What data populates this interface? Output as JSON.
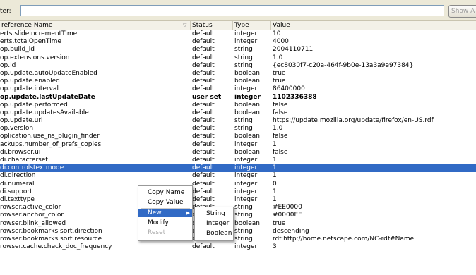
{
  "filter": {
    "label": "ter:",
    "value": "",
    "show_button": "Show A"
  },
  "columns": {
    "name": "reference Name",
    "status": "Status",
    "type": "Type",
    "value": "Value"
  },
  "rows": [
    {
      "name": "erts.slideIncrementTime",
      "status": "default",
      "type": "integer",
      "value": "10"
    },
    {
      "name": "erts.totalOpenTime",
      "status": "default",
      "type": "integer",
      "value": "4000"
    },
    {
      "name": "op.build_id",
      "status": "default",
      "type": "string",
      "value": "2004110711"
    },
    {
      "name": "op.extensions.version",
      "status": "default",
      "type": "string",
      "value": "1.0"
    },
    {
      "name": "op.id",
      "status": "default",
      "type": "string",
      "value": "{ec8030f7-c20a-464f-9b0e-13a3a9e97384}"
    },
    {
      "name": "op.update.autoUpdateEnabled",
      "status": "default",
      "type": "boolean",
      "value": "true"
    },
    {
      "name": "op.update.enabled",
      "status": "default",
      "type": "boolean",
      "value": "true"
    },
    {
      "name": "op.update.interval",
      "status": "default",
      "type": "integer",
      "value": "86400000"
    },
    {
      "name": "op.update.lastUpdateDate",
      "status": "user set",
      "type": "integer",
      "value": "1102336388"
    },
    {
      "name": "op.update.performed",
      "status": "default",
      "type": "boolean",
      "value": "false"
    },
    {
      "name": "op.update.updatesAvailable",
      "status": "default",
      "type": "boolean",
      "value": "false"
    },
    {
      "name": "op.update.url",
      "status": "default",
      "type": "string",
      "value": "https://update.mozilla.org/update/firefox/en-US.rdf"
    },
    {
      "name": "op.version",
      "status": "default",
      "type": "string",
      "value": "1.0"
    },
    {
      "name": "oplication.use_ns_plugin_finder",
      "status": "default",
      "type": "boolean",
      "value": "false"
    },
    {
      "name": "ackups.number_of_prefs_copies",
      "status": "default",
      "type": "integer",
      "value": "1"
    },
    {
      "name": "di.browser.ui",
      "status": "default",
      "type": "boolean",
      "value": "false"
    },
    {
      "name": "di.characterset",
      "status": "default",
      "type": "integer",
      "value": "1"
    },
    {
      "name": "di.controlstextmode",
      "status": "default",
      "type": "integer",
      "value": "1"
    },
    {
      "name": "di.direction",
      "status": "default",
      "type": "integer",
      "value": "1"
    },
    {
      "name": "di.numeral",
      "status": "default",
      "type": "integer",
      "value": "0"
    },
    {
      "name": "di.support",
      "status": "default",
      "type": "integer",
      "value": "1"
    },
    {
      "name": "di.texttype",
      "status": "default",
      "type": "integer",
      "value": "1"
    },
    {
      "name": "rowser.active_color",
      "status": "default",
      "type": "string",
      "value": "#EE0000"
    },
    {
      "name": "rowser.anchor_color",
      "status": "default",
      "type": "string",
      "value": "#0000EE"
    },
    {
      "name": "rowser.blink_allowed",
      "status": "default",
      "type": "boolean",
      "value": "true"
    },
    {
      "name": "rowser.bookmarks.sort.direction",
      "status": "default",
      "type": "string",
      "value": "descending"
    },
    {
      "name": "rowser.bookmarks.sort.resource",
      "status": "default",
      "type": "string",
      "value": "rdf:http://home.netscape.com/NC-rdf#Name"
    },
    {
      "name": "rowser.cache.check_doc_frequency",
      "status": "default",
      "type": "integer",
      "value": "3"
    }
  ],
  "context_menu": {
    "copy_name": "Copy Name",
    "copy_value": "Copy Value",
    "new": "New",
    "modify": "Modify",
    "reset": "Reset",
    "submenu": {
      "string": "String",
      "integer": "Integer",
      "boolean": "Boolean"
    }
  },
  "colors": {
    "selection": "#316ac5",
    "chrome": "#ece9d8"
  }
}
